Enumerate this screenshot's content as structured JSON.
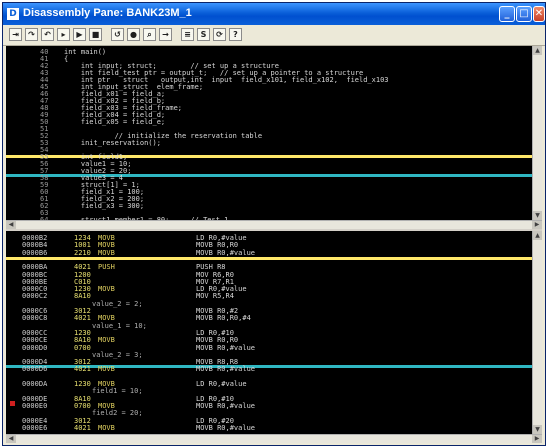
{
  "window": {
    "title": "Disassembly Pane: BANK23M_1",
    "title_icon": "disassembly-window-icon",
    "buttons": {
      "minimize": "_",
      "maximize": "□",
      "close": "✕"
    }
  },
  "toolbar": {
    "buttons": [
      {
        "name": "step-into-icon",
        "glyph": "⇥"
      },
      {
        "name": "step-over-icon",
        "glyph": "↷"
      },
      {
        "name": "step-out-icon",
        "glyph": "↶"
      },
      {
        "name": "run-to-cursor-icon",
        "glyph": "▸"
      },
      {
        "name": "go-icon",
        "glyph": "▶"
      },
      {
        "name": "halt-icon",
        "glyph": "■"
      },
      {
        "name": "reset-icon",
        "glyph": "↺"
      },
      {
        "name": "breakpoint-icon",
        "glyph": "●"
      },
      {
        "name": "find-icon",
        "glyph": "⌕"
      },
      {
        "name": "goto-address-icon",
        "glyph": "→"
      },
      {
        "name": "mixed-mode-icon",
        "glyph": "≡"
      },
      {
        "name": "source-icon",
        "glyph": "S"
      },
      {
        "name": "refresh-icon",
        "glyph": "⟳"
      },
      {
        "name": "help-icon",
        "glyph": "?"
      }
    ]
  },
  "source_pane": {
    "lines": [
      {
        "num": "40",
        "text": "int main()"
      },
      {
        "num": "41",
        "text": "{"
      },
      {
        "num": "42",
        "text": "    int input; struct;        // set up a structure"
      },
      {
        "num": "43",
        "text": "    int field_test ptr = output_t;   // set up a pointer to a structure"
      },
      {
        "num": "44",
        "text": "    int ptr   struct   output,int  input  field_x101, field_x102,  field_x103"
      },
      {
        "num": "45",
        "text": "    int input_struct  elem_frame;"
      },
      {
        "num": "46",
        "text": "    field_x01 = field_a;"
      },
      {
        "num": "47",
        "text": "    field_x02 = field_b;"
      },
      {
        "num": "48",
        "text": "    field_x03 = field_frame;"
      },
      {
        "num": "49",
        "text": "    field_x04 = field_d;"
      },
      {
        "num": "50",
        "text": "    field_x05 = field_e;"
      },
      {
        "num": "51",
        "text": ""
      },
      {
        "num": "52",
        "text": "            // initialize the reservation table"
      },
      {
        "num": "53",
        "text": "    init_reservation();"
      },
      {
        "num": "54",
        "text": ""
      },
      {
        "num": "55",
        "text": "    int field1;"
      },
      {
        "num": "56",
        "text": "    value1 = 10;"
      },
      {
        "num": "57",
        "text": "    value2 = 20;"
      },
      {
        "num": "58",
        "text": "    value3 = 4"
      },
      {
        "num": "59",
        "text": "    struct[1] = 1;"
      },
      {
        "num": "60",
        "text": "    field_x1 = 100;"
      },
      {
        "num": "61",
        "text": "    field_x2 = 200;"
      },
      {
        "num": "62",
        "text": "    field_x3 = 300;"
      },
      {
        "num": "63",
        "text": ""
      },
      {
        "num": "64",
        "text": "    struct1.member1 = 80;     // Test 1"
      }
    ]
  },
  "disasm_pane": {
    "rows": [
      {
        "addr": "0000B2",
        "op": "1234",
        "mne": "MOVB",
        "src": "",
        "ops": "LD R0,#value"
      },
      {
        "addr": "0000B4",
        "op": "1001",
        "mne": "MOVB",
        "src": "",
        "ops": "MOVB R0,R0"
      },
      {
        "addr": "0000B6",
        "op": "2210",
        "mne": "MOVB",
        "src": "",
        "ops": "MOVB R0,#value"
      },
      {
        "addr": "",
        "op": "",
        "mne": "",
        "src": "",
        "ops": ""
      },
      {
        "addr": "0000BA",
        "op": "4021",
        "mne": "PUSH",
        "src": "",
        "ops": "PUSH R8"
      },
      {
        "addr": "0000BC",
        "op": "1200",
        "mne": "",
        "src": "",
        "ops": "MOV R6,R0"
      },
      {
        "addr": "0000BE",
        "op": "C010",
        "mne": "",
        "src": "",
        "ops": "MOV R7,R1"
      },
      {
        "addr": "0000C0",
        "op": "1230",
        "mne": "MOVB",
        "src": "",
        "ops": "LD R0,#value"
      },
      {
        "addr": "0000C2",
        "op": "8A10",
        "mne": "",
        "src": "",
        "ops": "MOV R5,R4"
      },
      {
        "addr": "",
        "op": "",
        "mne": "",
        "src": "value_2 = 2;",
        "ops": ""
      },
      {
        "addr": "0000C6",
        "op": "3012",
        "mne": "",
        "src": "",
        "ops": "MOVB R0,#2"
      },
      {
        "addr": "0000C8",
        "op": "4021",
        "mne": "MOVB",
        "src": "",
        "ops": "MOVB R0,R0,#4"
      },
      {
        "addr": "",
        "op": "",
        "mne": "",
        "src": "value_1 = 10;",
        "ops": ""
      },
      {
        "addr": "0000CC",
        "op": "1230",
        "mne": "",
        "src": "",
        "ops": "LD R0,#10"
      },
      {
        "addr": "0000CE",
        "op": "8A10",
        "mne": "MOVB",
        "src": "",
        "ops": "MOVB R0,R0"
      },
      {
        "addr": "0000D0",
        "op": "0700",
        "mne": "",
        "src": "",
        "ops": "MOVB R0,#value"
      },
      {
        "addr": "",
        "op": "",
        "mne": "",
        "src": "value_2 = 3;",
        "ops": ""
      },
      {
        "addr": "0000D4",
        "op": "3012",
        "mne": "",
        "src": "",
        "ops": "MOVB R8,R8"
      },
      {
        "addr": "0000D6",
        "op": "4021",
        "mne": "MOVB",
        "src": "",
        "ops": "MOVB R0,#value"
      },
      {
        "addr": "",
        "op": "",
        "mne": "",
        "src": "",
        "ops": ""
      },
      {
        "addr": "0000DA",
        "op": "1230",
        "mne": "MOVB",
        "src": "",
        "ops": "LD R0,#value"
      },
      {
        "addr": "",
        "op": "",
        "mne": "",
        "src": "field1 = 10;",
        "ops": ""
      },
      {
        "addr": "0000DE",
        "op": "8A10",
        "mne": "",
        "src": "",
        "ops": "LD R0,#10"
      },
      {
        "addr": "0000E0",
        "op": "0700",
        "mne": "MOVB",
        "src": "",
        "ops": "MOVB R0,#value"
      },
      {
        "addr": "",
        "op": "",
        "mne": "",
        "src": "field2 = 20;",
        "ops": ""
      },
      {
        "addr": "0000E4",
        "op": "3012",
        "mne": "",
        "src": "",
        "ops": "LD R0,#20"
      },
      {
        "addr": "0000E6",
        "op": "4021",
        "mne": "MOVB",
        "src": "",
        "ops": "MOVB R0,#value"
      }
    ]
  },
  "colors": {
    "highlight_yellow": "#ffe86a",
    "highlight_cyan": "#2fb7c2",
    "pane_background": "#000000",
    "titlebar": "#0a5fd8"
  }
}
